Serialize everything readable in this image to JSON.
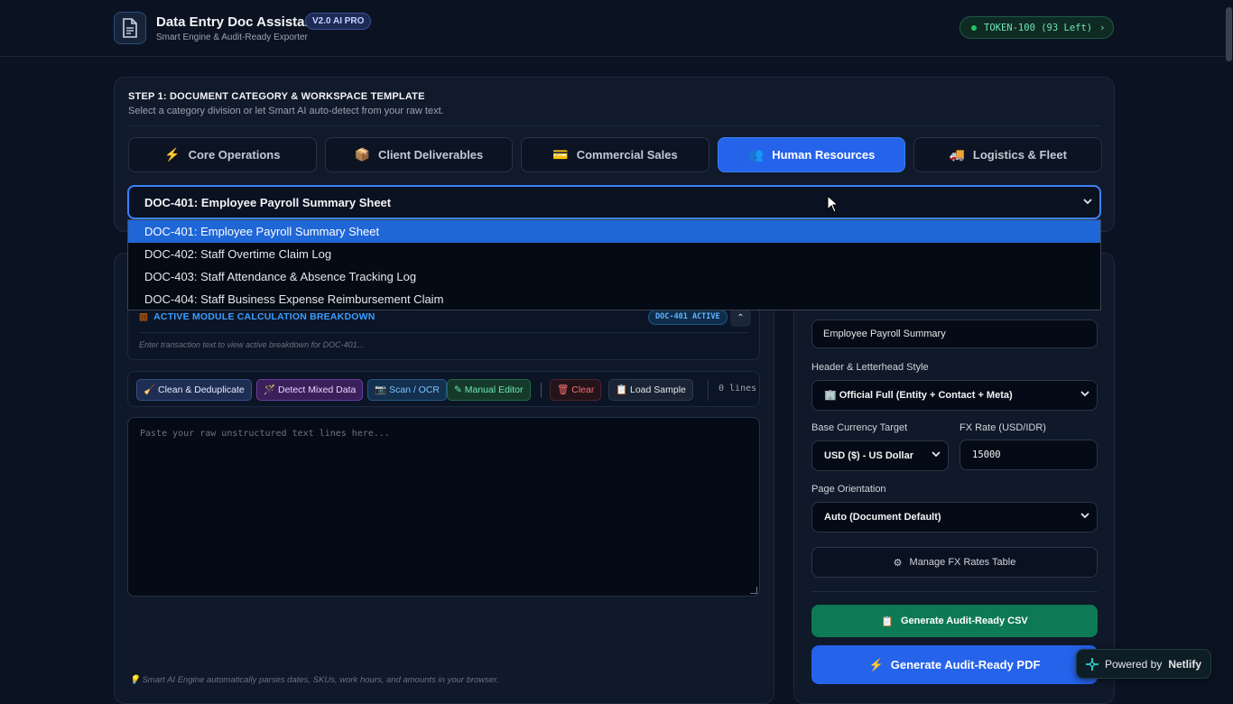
{
  "header": {
    "title": "Data Entry Doc Assistant",
    "badge": "V2.0 AI PRO",
    "subtitle": "Smart Engine & Audit-Ready Exporter",
    "token": "TOKEN-100 (93 Left)",
    "token_chevron": "›"
  },
  "step1": {
    "title": "STEP 1: DOCUMENT CATEGORY & WORKSPACE TEMPLATE",
    "description": "Select a category division or let Smart AI auto-detect from your raw text.",
    "tabs": [
      {
        "icon": "⚡",
        "label": "Core Operations",
        "active": false
      },
      {
        "icon": "📦",
        "label": "Client Deliverables",
        "active": false
      },
      {
        "icon": "💳",
        "label": "Commercial Sales",
        "active": false
      },
      {
        "icon": "👥",
        "label": "Human Resources",
        "active": true
      },
      {
        "icon": "🚚",
        "label": "Logistics & Fleet",
        "active": false
      }
    ],
    "selected_template": "DOC-401: Employee Payroll Summary Sheet",
    "options": [
      "DOC-401: Employee Payroll Summary Sheet",
      "DOC-402: Staff Overtime Claim Log",
      "DOC-403: Staff Attendance & Absence Tracking Log",
      "DOC-404: Staff Business Expense Reimbursement Claim"
    ]
  },
  "module": {
    "icon": "▥",
    "title": "ACTIVE MODULE CALCULATION BREAKDOWN",
    "tag": "DOC-401 ACTIVE",
    "collapse": "⌃",
    "hint": "Enter transaction text to view active breakdown for DOC-401..."
  },
  "toolbar": {
    "clean": "🧹 Clean & Deduplicate",
    "detect": "🪄 Detect Mixed Data",
    "scan": "📷 Scan / OCR",
    "manual": "✎ Manual Editor",
    "clear": "🗑 Clear",
    "load": "📋 Load Sample",
    "lines": "0 lines"
  },
  "editor": {
    "placeholder": "Paste your raw unstructured text lines here..."
  },
  "footnote": "💡 Smart AI Engine automatically parses dates, SKUs, work hours, and amounts in your browser.",
  "settings": {
    "doc_title_value": "Employee Payroll Summary",
    "letterhead_label": "Header & Letterhead Style",
    "letterhead_value": "🏢 Official Full (Entity + Contact + Meta)",
    "currency_label": "Base Currency Target",
    "currency_value": "USD ($) - US Dollar",
    "fx_label": "FX Rate (USD/IDR)",
    "fx_value": "15000",
    "orientation_label": "Page Orientation",
    "orientation_value": "Auto (Document Default)",
    "manage_fx": "Manage FX Rates Table",
    "csv_button": "Generate Audit-Ready CSV",
    "pdf_button": "Generate Audit-Ready PDF"
  },
  "netlify": {
    "prefix": "Powered by",
    "brand": "Netlify"
  }
}
